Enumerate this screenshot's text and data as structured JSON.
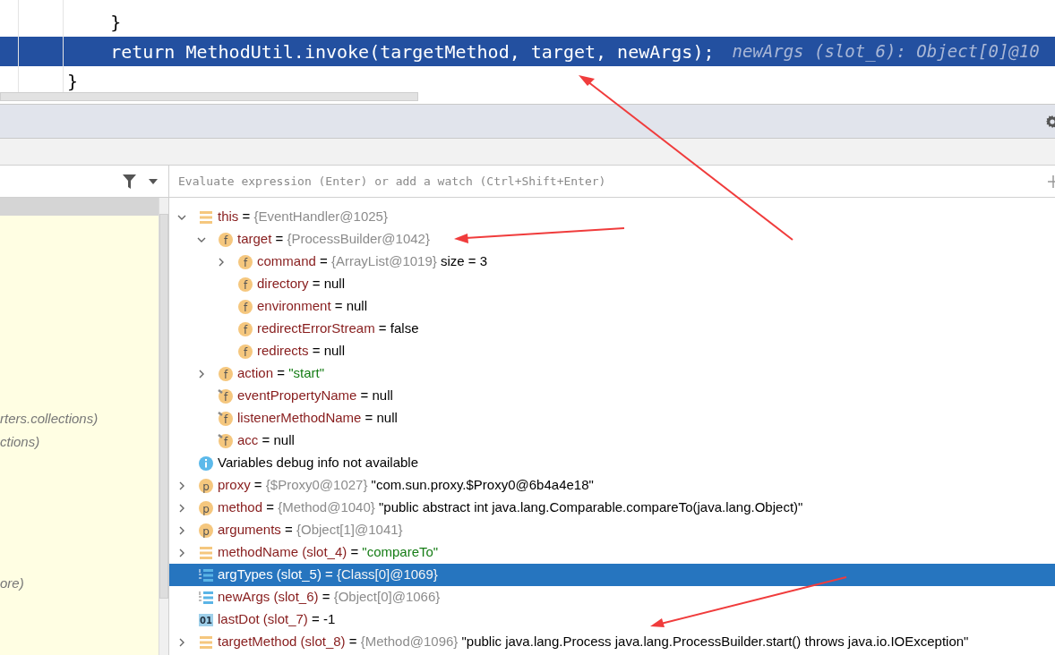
{
  "editor": {
    "lines": [
      {
        "text": "    }",
        "current": false
      },
      {
        "text": "    return MethodUtil.invoke(targetMethod, target, newArgs);",
        "current": true,
        "hint": "newArgs (slot_6): Object[0]@10"
      },
      {
        "text": "}",
        "current": false
      }
    ]
  },
  "watch_field": {
    "placeholder": "Evaluate expression (Enter) or add a watch (Ctrl+Shift+Enter)"
  },
  "frames": [
    {
      "text": "rters.collections)"
    },
    {
      "text": "ctions)"
    },
    {
      "text": "ore)"
    }
  ],
  "variables": [
    {
      "icon": {
        "kind": "local"
      },
      "expanded": true,
      "selected": false,
      "parts": [
        {
          "kind": "name",
          "text": "this"
        },
        {
          "kind": "op",
          "text": "="
        },
        {
          "kind": "ref",
          "text": "{EventHandler@1025}"
        }
      ],
      "children": [
        {
          "icon": {
            "kind": "field",
            "letter": "f"
          },
          "expanded": true,
          "selected": false,
          "parts": [
            {
              "kind": "name",
              "text": "target"
            },
            {
              "kind": "op",
              "text": "="
            },
            {
              "kind": "ref",
              "text": "{ProcessBuilder@1042}"
            }
          ],
          "children": [
            {
              "icon": {
                "kind": "field",
                "letter": "f"
              },
              "expanded": false,
              "selected": false,
              "parts": [
                {
                  "kind": "name",
                  "text": "command"
                },
                {
                  "kind": "op",
                  "text": "="
                },
                {
                  "kind": "ref",
                  "text": "{ArrayList@1019}"
                },
                {
                  "kind": "plain",
                  "text": " size = 3"
                }
              ]
            },
            {
              "icon": {
                "kind": "field",
                "letter": "f"
              },
              "selected": false,
              "parts": [
                {
                  "kind": "name",
                  "text": "directory"
                },
                {
                  "kind": "op",
                  "text": "="
                },
                {
                  "kind": "plain",
                  "text": "null"
                }
              ]
            },
            {
              "icon": {
                "kind": "field",
                "letter": "f"
              },
              "selected": false,
              "parts": [
                {
                  "kind": "name",
                  "text": "environment"
                },
                {
                  "kind": "op",
                  "text": "="
                },
                {
                  "kind": "plain",
                  "text": "null"
                }
              ]
            },
            {
              "icon": {
                "kind": "field",
                "letter": "f"
              },
              "selected": false,
              "parts": [
                {
                  "kind": "name",
                  "text": "redirectErrorStream"
                },
                {
                  "kind": "op",
                  "text": "="
                },
                {
                  "kind": "plain",
                  "text": "false"
                }
              ]
            },
            {
              "icon": {
                "kind": "field",
                "letter": "f"
              },
              "selected": false,
              "parts": [
                {
                  "kind": "name",
                  "text": "redirects"
                },
                {
                  "kind": "op",
                  "text": "="
                },
                {
                  "kind": "plain",
                  "text": "null"
                }
              ]
            }
          ]
        },
        {
          "icon": {
            "kind": "field",
            "letter": "f"
          },
          "expanded": false,
          "selected": false,
          "parts": [
            {
              "kind": "name",
              "text": "action"
            },
            {
              "kind": "op",
              "text": "="
            },
            {
              "kind": "string",
              "text": "\"start\""
            }
          ]
        },
        {
          "icon": {
            "kind": "pinned-field",
            "letter": "f"
          },
          "selected": false,
          "parts": [
            {
              "kind": "name",
              "text": "eventPropertyName"
            },
            {
              "kind": "op",
              "text": "="
            },
            {
              "kind": "plain",
              "text": "null"
            }
          ]
        },
        {
          "icon": {
            "kind": "pinned-field",
            "letter": "f"
          },
          "selected": false,
          "parts": [
            {
              "kind": "name",
              "text": "listenerMethodName"
            },
            {
              "kind": "op",
              "text": "="
            },
            {
              "kind": "plain",
              "text": "null"
            }
          ]
        },
        {
          "icon": {
            "kind": "pinned-field",
            "letter": "f"
          },
          "selected": false,
          "parts": [
            {
              "kind": "name",
              "text": "acc"
            },
            {
              "kind": "op",
              "text": "="
            },
            {
              "kind": "plain",
              "text": "null"
            }
          ]
        }
      ]
    },
    {
      "icon": {
        "kind": "info"
      },
      "selected": false,
      "parts": [
        {
          "kind": "plain",
          "text": "Variables debug info not available"
        }
      ]
    },
    {
      "icon": {
        "kind": "param",
        "letter": "p"
      },
      "expanded": false,
      "selected": false,
      "parts": [
        {
          "kind": "name",
          "text": "proxy"
        },
        {
          "kind": "op",
          "text": "="
        },
        {
          "kind": "ref",
          "text": "{$Proxy0@1027}"
        },
        {
          "kind": "plain",
          "text": "\"com.sun.proxy.$Proxy0@6b4a4e18\""
        }
      ]
    },
    {
      "icon": {
        "kind": "param",
        "letter": "p"
      },
      "expanded": false,
      "selected": false,
      "parts": [
        {
          "kind": "name",
          "text": "method"
        },
        {
          "kind": "op",
          "text": "="
        },
        {
          "kind": "ref",
          "text": "{Method@1040}"
        },
        {
          "kind": "plain",
          "text": "\"public abstract int java.lang.Comparable.compareTo(java.lang.Object)\""
        }
      ]
    },
    {
      "icon": {
        "kind": "param",
        "letter": "p"
      },
      "expanded": false,
      "selected": false,
      "parts": [
        {
          "kind": "name",
          "text": "arguments"
        },
        {
          "kind": "op",
          "text": "="
        },
        {
          "kind": "ref",
          "text": "{Object[1]@1041}"
        }
      ]
    },
    {
      "icon": {
        "kind": "local"
      },
      "expanded": false,
      "selected": false,
      "parts": [
        {
          "kind": "name",
          "text": "methodName (slot_4)"
        },
        {
          "kind": "op",
          "text": "="
        },
        {
          "kind": "string",
          "text": "\"compareTo\""
        }
      ]
    },
    {
      "icon": {
        "kind": "array"
      },
      "selected": true,
      "parts": [
        {
          "kind": "name",
          "text": "argTypes (slot_5)"
        },
        {
          "kind": "op",
          "text": "="
        },
        {
          "kind": "ref",
          "text": "{Class[0]@1069}"
        }
      ]
    },
    {
      "icon": {
        "kind": "array"
      },
      "selected": false,
      "parts": [
        {
          "kind": "name",
          "text": "newArgs (slot_6)"
        },
        {
          "kind": "op",
          "text": "="
        },
        {
          "kind": "ref",
          "text": "{Object[0]@1066}"
        }
      ]
    },
    {
      "icon": {
        "kind": "primitive",
        "letter": "01"
      },
      "selected": false,
      "parts": [
        {
          "kind": "name",
          "text": "lastDot (slot_7)"
        },
        {
          "kind": "op",
          "text": "="
        },
        {
          "kind": "plain",
          "text": "-1"
        }
      ]
    },
    {
      "icon": {
        "kind": "local"
      },
      "expanded": false,
      "selected": false,
      "parts": [
        {
          "kind": "name",
          "text": "targetMethod (slot_8)"
        },
        {
          "kind": "op",
          "text": "="
        },
        {
          "kind": "ref",
          "text": "{Method@1096}"
        },
        {
          "kind": "plain",
          "text": "\"public java.lang.Process java.lang.ProcessBuilder.start() throws java.io.IOException\""
        }
      ]
    }
  ]
}
